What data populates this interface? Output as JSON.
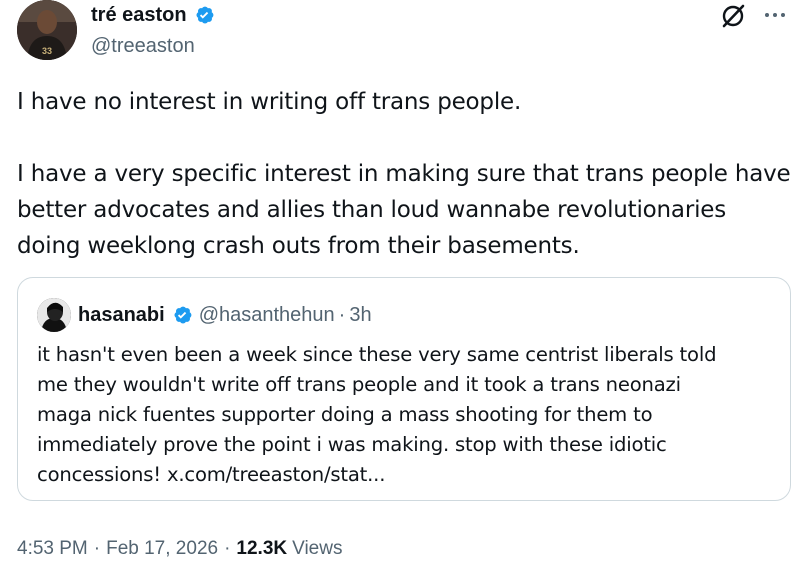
{
  "author": {
    "name": "tré easton",
    "handle": "@treeaston"
  },
  "tweet": {
    "paragraphs": [
      [
        "I have no interest in writing off trans people."
      ],
      [
        "I have a very specific interest in making sure that trans people have",
        "better advocates and allies than loud wannabe revolutionaries",
        "doing weeklong crash outs from their basements."
      ]
    ]
  },
  "quote": {
    "name": "hasanabi",
    "handle": "@hasanthehun",
    "dot": "·",
    "time": "3h",
    "lines": [
      "it hasn't even been a week since these very same centrist liberals told",
      "me they wouldn't write off trans people and it took a trans neonazi",
      "maga nick fuentes supporter doing a mass shooting for them to",
      "immediately prove the point i was making. stop with these idiotic",
      "concessions! x.com/treeaston/stat..."
    ]
  },
  "meta": {
    "time": "4:53 PM",
    "sep1": "·",
    "date": "Feb 17, 2026",
    "sep2": "·",
    "views_count": "12.3K",
    "views_label": "Views"
  },
  "colors": {
    "verified": "#1d9bf0",
    "secondary_text": "#536471",
    "primary_text": "#0f1419",
    "border": "#cfd9de"
  },
  "icons": {
    "verified": "verified-badge-icon",
    "grok": "grok-icon",
    "more": "more-dots-icon"
  }
}
